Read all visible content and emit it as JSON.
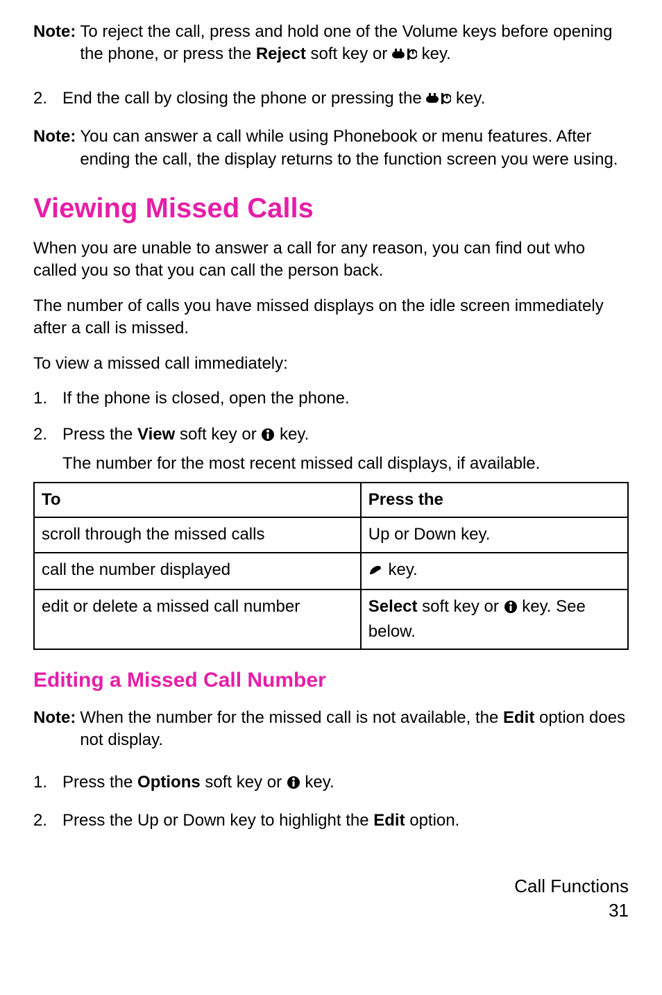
{
  "note1": {
    "label": "Note:",
    "text_a": "To reject the call, press and hold one of the Volume keys before opening the phone, or press the ",
    "reject": "Reject",
    "text_b": " soft key or ",
    "text_c": " key."
  },
  "step_end": {
    "num": "2.",
    "text_a": "End the call by closing the phone or pressing the ",
    "text_b": " key."
  },
  "note2": {
    "label": "Note:",
    "text": "You can answer a call while using Phonebook or menu features. After ending the call, the display returns to the function screen you were using."
  },
  "h1": "Viewing Missed Calls",
  "para1": "When you are unable to answer a call for any reason, you can find out who called you so that you can call the person back.",
  "para2": "The number of calls you have missed displays on the idle screen immediately after a call is missed.",
  "para3": "To view a missed call immediately:",
  "li1": {
    "num": "1.",
    "text": "If the phone is closed, open the phone."
  },
  "li2": {
    "num": "2.",
    "text_a": "Press the ",
    "view": "View",
    "text_b": " soft key or ",
    "text_c": " key."
  },
  "li2_sub": "The number for the most recent missed call displays, if available.",
  "table": {
    "head_to": "To",
    "head_press": "Press the",
    "rows": [
      {
        "to": "scroll through the missed calls",
        "press": "Up or Down key."
      },
      {
        "to": "call the number displayed",
        "press_suffix": " key."
      },
      {
        "to": "edit or delete a missed call number",
        "press_select": "Select",
        "press_mid": " soft key or ",
        "press_suffix": " key. See below."
      }
    ]
  },
  "h2": "Editing a Missed Call Number",
  "note3": {
    "label": "Note:",
    "text_a": "When the number for the missed call is not available, the ",
    "edit": "Edit",
    "text_b": " option does not display."
  },
  "ed_li1": {
    "num": "1.",
    "text_a": "Press the ",
    "options": "Options",
    "text_b": " soft key or ",
    "text_c": " key."
  },
  "ed_li2": {
    "num": "2.",
    "text_a": " Press the Up or Down key to highlight the ",
    "edit": "Edit",
    "text_b": " option."
  },
  "footer": {
    "section": "Call Functions",
    "page": "31"
  }
}
